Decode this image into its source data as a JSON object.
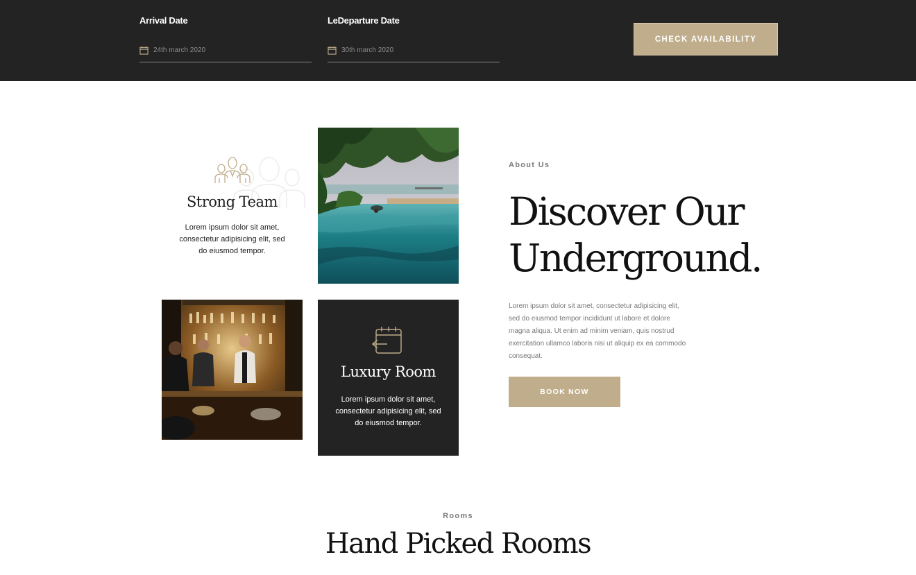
{
  "booking": {
    "arrival": {
      "label": "Arrival Date",
      "value": "24th march 2020",
      "icon": "calendar-icon"
    },
    "departure": {
      "label": "LeDeparture Date",
      "value": "30th march 2020",
      "icon": "calendar-icon"
    },
    "check_button": "CHECK AVAILABILITY"
  },
  "features": {
    "team": {
      "icon": "team-icon",
      "title": "Strong Team",
      "text": "Lorem ipsum dolor sit amet, consectetur adipisicing elit, sed do eiusmod tempor."
    },
    "luxury": {
      "icon": "calendar-icon",
      "title": "Luxury Room",
      "text": "Lorem ipsum dolor sit amet, consectetur adipisicing elit, sed do eiusmod tempor."
    }
  },
  "about": {
    "eyebrow": "About Us",
    "heading_line1": "Discover Our",
    "heading_line2": "Underground.",
    "text": "Lorem ipsum dolor sit amet, consectetur adipisicing elit, sed do eiusmod tempor incididunt ut labore et dolore magna aliqua. Ut enim ad minim veniam, quis nostrud exercitation ullamco laboris nisi ut aliquip ex ea commodo consequat.",
    "button": "BOOK NOW"
  },
  "rooms": {
    "eyebrow": "Rooms",
    "heading": "Hand Picked Rooms"
  },
  "colors": {
    "dark": "#232323",
    "accent": "#c0ad8b"
  }
}
